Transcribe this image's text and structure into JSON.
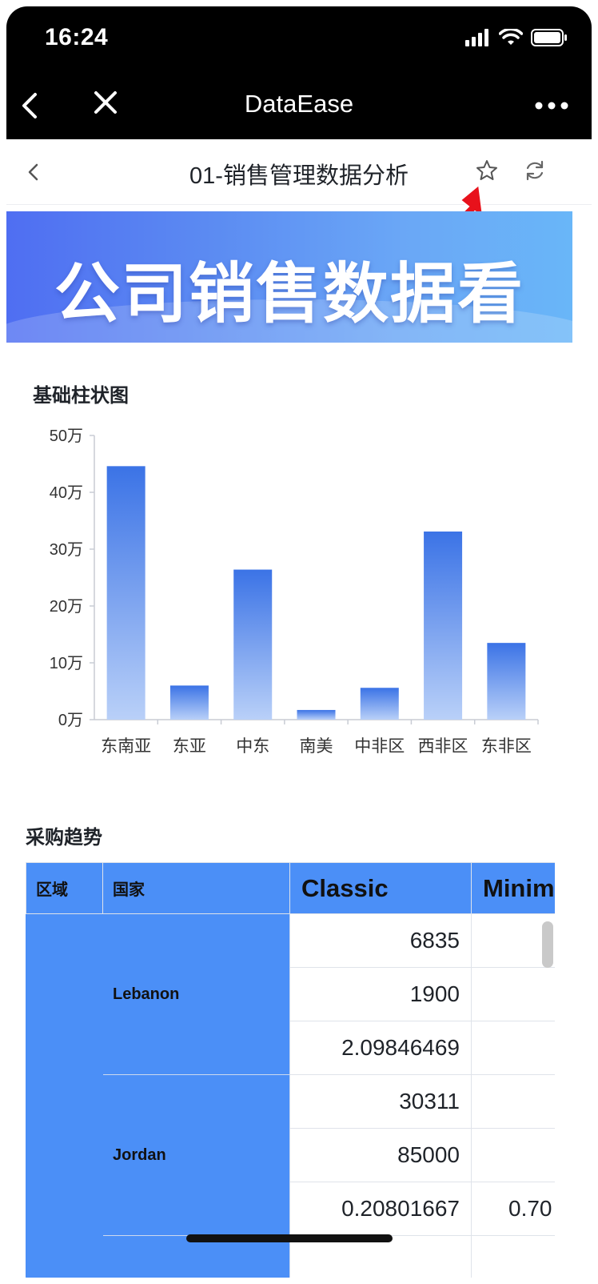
{
  "status": {
    "time": "16:24"
  },
  "nav": {
    "title": "DataEase"
  },
  "header": {
    "title": "01-销售管理数据分析"
  },
  "banner": {
    "title": "公司销售数据看"
  },
  "chart_section": {
    "title": "基础柱状图"
  },
  "chart_data": {
    "type": "bar",
    "categories": [
      "东南亚",
      "东亚",
      "中东",
      "南美",
      "中非区",
      "西非区",
      "东非区"
    ],
    "values": [
      446000,
      60000,
      264000,
      17000,
      56000,
      331000,
      135000
    ],
    "ylim": [
      0,
      500000
    ],
    "yticks": [
      "0万",
      "10万",
      "20万",
      "30万",
      "40万",
      "50万"
    ],
    "bar_color_top": "#3b73e6",
    "bar_color_bottom": "#b9d0f8",
    "grid": false
  },
  "table_section": {
    "title": "采购趋势"
  },
  "table": {
    "headers": [
      "区域",
      "国家",
      "Classic",
      "Minim"
    ],
    "groups": [
      {
        "country": "Lebanon",
        "values": [
          "6835",
          "1900",
          "2.09846469"
        ],
        "values2": [
          "",
          "",
          ""
        ]
      },
      {
        "country": "Jordan",
        "values": [
          "30311",
          "85000",
          "0.20801667"
        ],
        "values2": [
          "",
          "",
          "0.70"
        ]
      }
    ]
  },
  "colors": {
    "accent": "#4b8ff7",
    "pointer": "#e8111b"
  }
}
